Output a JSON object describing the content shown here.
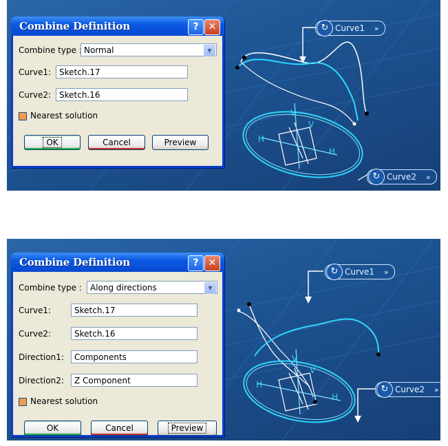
{
  "panels": [
    {
      "dialog": {
        "title": "Combine Definition",
        "help": "?",
        "close": "✕",
        "combine_type_label": "Combine type :",
        "combine_type_value": "Normal",
        "curve1_label": "Curve1:",
        "curve1_value": "Sketch.17",
        "curve2_label": "Curve2:",
        "curve2_value": "Sketch.16",
        "nearest_label": "Nearest solution",
        "nearest_checked": true,
        "ok": "OK",
        "cancel": "Cancel",
        "preview": "Preview"
      },
      "viewport": {
        "chip1": "Curve1",
        "chip2": "Curve2",
        "chip_icon": "curve-icon",
        "arrow_glyph": "»",
        "axis_h": "H",
        "axis_v": "V"
      }
    },
    {
      "dialog": {
        "title": "Combine Definition",
        "help": "?",
        "close": "✕",
        "combine_type_label": "Combine type :",
        "combine_type_value": "Along directions",
        "curve1_label": "Curve1:",
        "curve1_value": "Sketch.17",
        "curve2_label": "Curve2:",
        "curve2_value": "Sketch.16",
        "direction1_label": "Direction1:",
        "direction1_value": "Components",
        "direction2_label": "Direction2:",
        "direction2_value": "Z Component",
        "nearest_label": "Nearest solution",
        "nearest_checked": true,
        "ok": "OK",
        "cancel": "Cancel",
        "preview": "Preview"
      },
      "viewport": {
        "chip1": "Curve1",
        "chip2": "Curve2",
        "chip_icon": "curve-icon",
        "arrow_glyph": "»",
        "axis_h": "H",
        "axis_v": "V"
      }
    }
  ],
  "colors": {
    "titlebar": "#0a5ae4",
    "viewport": "#1c5391",
    "curve_highlight": "#2fd8ff",
    "checkbox": "#f09a52"
  }
}
